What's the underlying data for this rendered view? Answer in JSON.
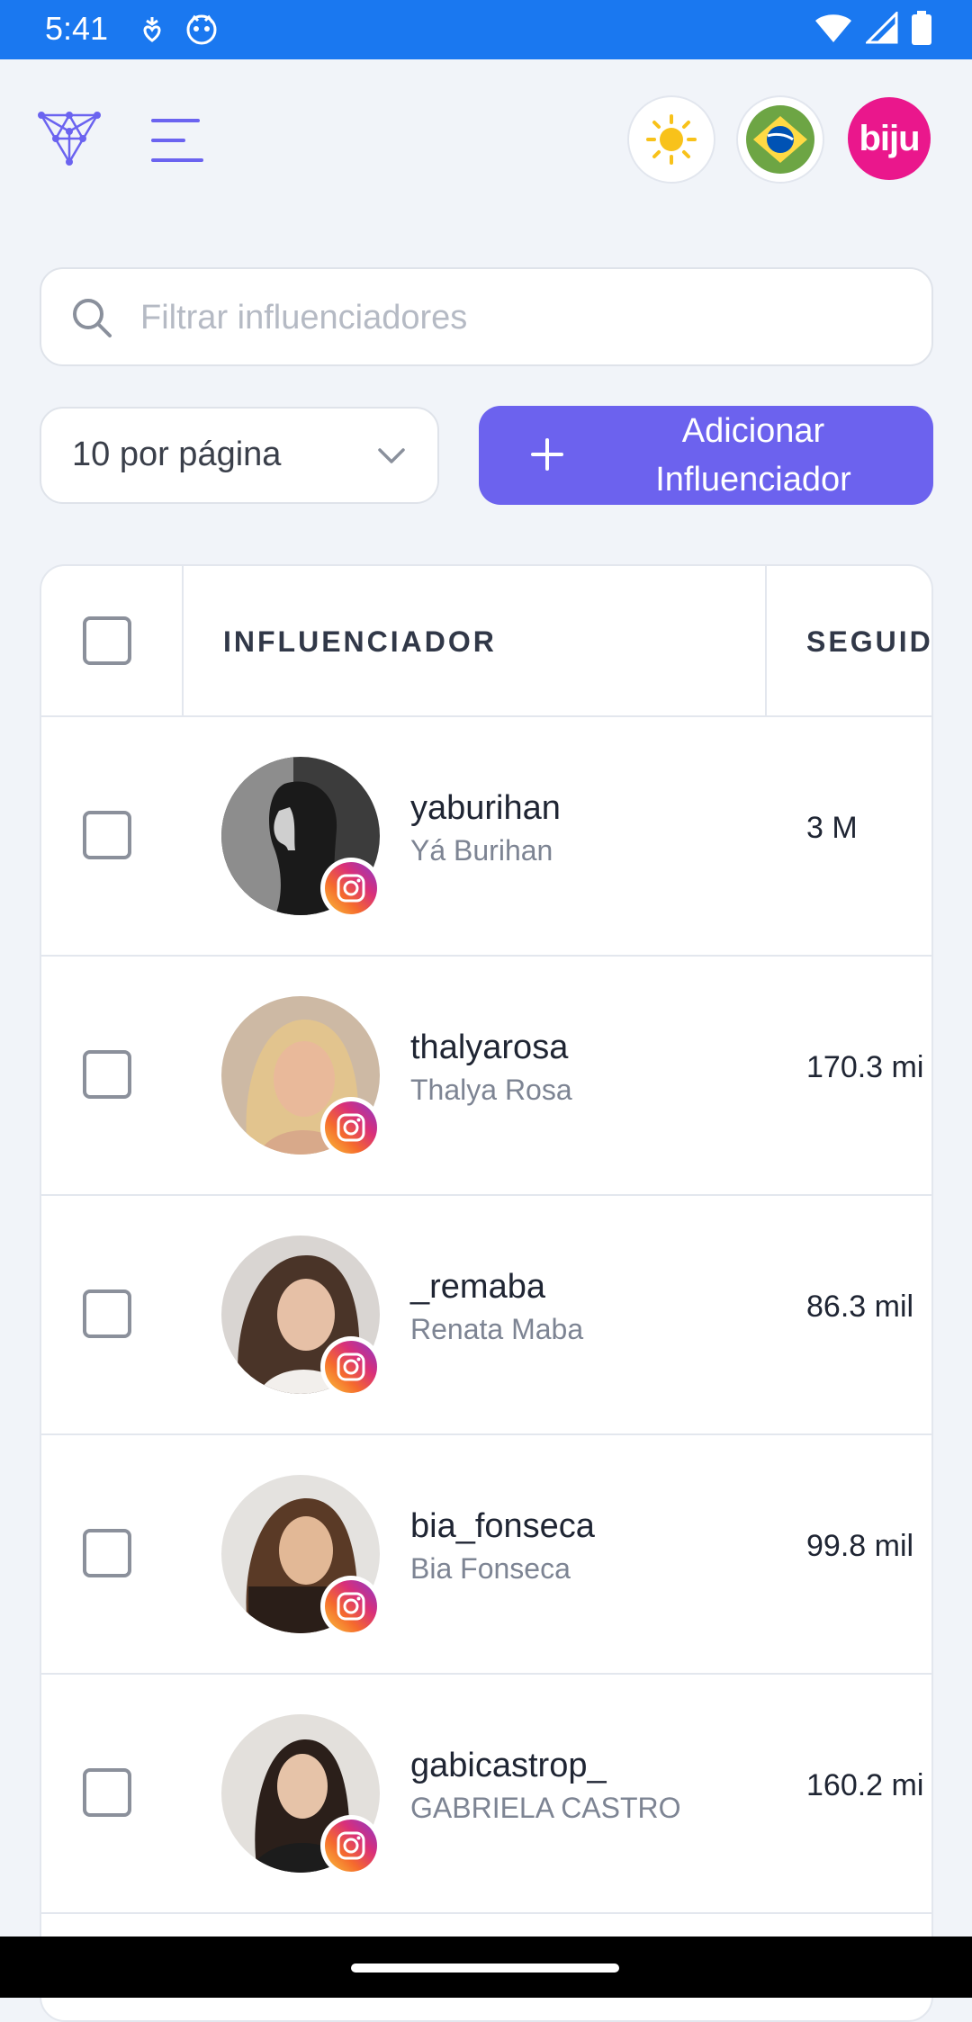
{
  "status_bar": {
    "time": "5:41"
  },
  "header": {
    "logo_icon": "triangle-network-logo",
    "menu_icon": "hamburger-menu-icon",
    "theme_icon": "sun-icon",
    "language_icon": "brazil-flag-icon",
    "account_avatar_text": "biju"
  },
  "search": {
    "placeholder": "Filtrar influenciadores",
    "value": ""
  },
  "pagination": {
    "per_page_label": "10 por página"
  },
  "add_button": {
    "label": "Adicionar\nInfluenciador"
  },
  "table": {
    "columns": [
      "INFLUENCIADOR",
      "SEGUIDO"
    ],
    "rows": [
      {
        "username": "yaburihan",
        "name": "Yá Burihan",
        "followers": "3 M"
      },
      {
        "username": "thalyarosa",
        "name": "Thalya Rosa",
        "followers": "170.3 mi"
      },
      {
        "username": "_remaba",
        "name": "Renata Maba",
        "followers": "86.3 mil"
      },
      {
        "username": "bia_fonseca",
        "name": "Bia Fonseca",
        "followers": "99.8 mil"
      },
      {
        "username": "gabicastrop_",
        "name": "GABRIELA CASTRO",
        "followers": "160.2 mi"
      }
    ]
  },
  "colors": {
    "status_bar": "#1a78f0",
    "accent": "#6c62ee",
    "brand_pink": "#ea178c",
    "background": "#f1f4f9"
  }
}
